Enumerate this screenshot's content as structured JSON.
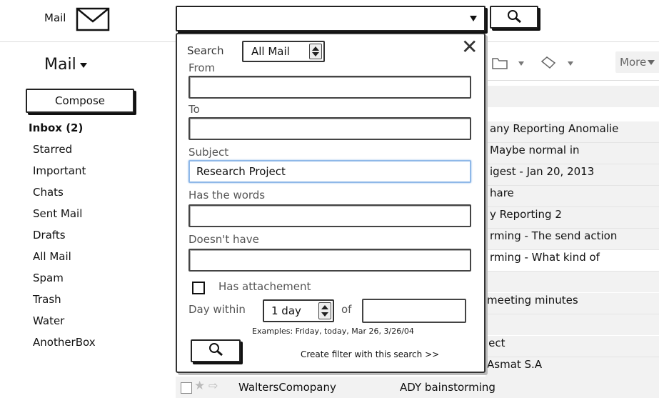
{
  "header": {
    "app_label": "Mail",
    "search_value": ""
  },
  "sidebar": {
    "title": "Mail",
    "compose_label": "Compose",
    "items": [
      {
        "label": "Inbox (2)",
        "bold": true
      },
      {
        "label": "Starred"
      },
      {
        "label": "Important"
      },
      {
        "label": "Chats"
      },
      {
        "label": "Sent Mail"
      },
      {
        "label": "Drafts"
      },
      {
        "label": "All Mail"
      },
      {
        "label": "Spam"
      },
      {
        "label": "Trash"
      },
      {
        "label": "Water"
      },
      {
        "label": "AnotherBox"
      }
    ]
  },
  "toolbar": {
    "more_label": "More"
  },
  "mail_rows": [
    "any Reporting Anomalie",
    "Maybe normal in",
    "igest - Jan 20, 2013",
    "hare",
    "y Reporting 2",
    "rming - The send action",
    "rming - What kind of",
    "meeting minutes",
    "ject",
    "Asmat S.A"
  ],
  "bottom_row": {
    "sender": "WaltersComopany",
    "subject": "ADY bainstorming"
  },
  "search_panel": {
    "search_label": "Search",
    "scope_value": "All Mail",
    "from_label": "From",
    "from_value": "",
    "to_label": "To",
    "to_value": "",
    "subject_label": "Subject",
    "subject_value": "Research Project",
    "has_words_label": "Has the words",
    "has_words_value": "",
    "doesnt_have_label": "Doesn't have",
    "doesnt_have_value": "",
    "has_attachment_label": "Has attachement",
    "has_attachment_checked": false,
    "day_within_label": "Day within",
    "day_within_value": "1 day",
    "of_label": "of",
    "of_value": "",
    "examples_text": "Examples: Friday, today, Mar 26, 3/26/04",
    "create_filter_label": "Create filter with this search >>"
  }
}
